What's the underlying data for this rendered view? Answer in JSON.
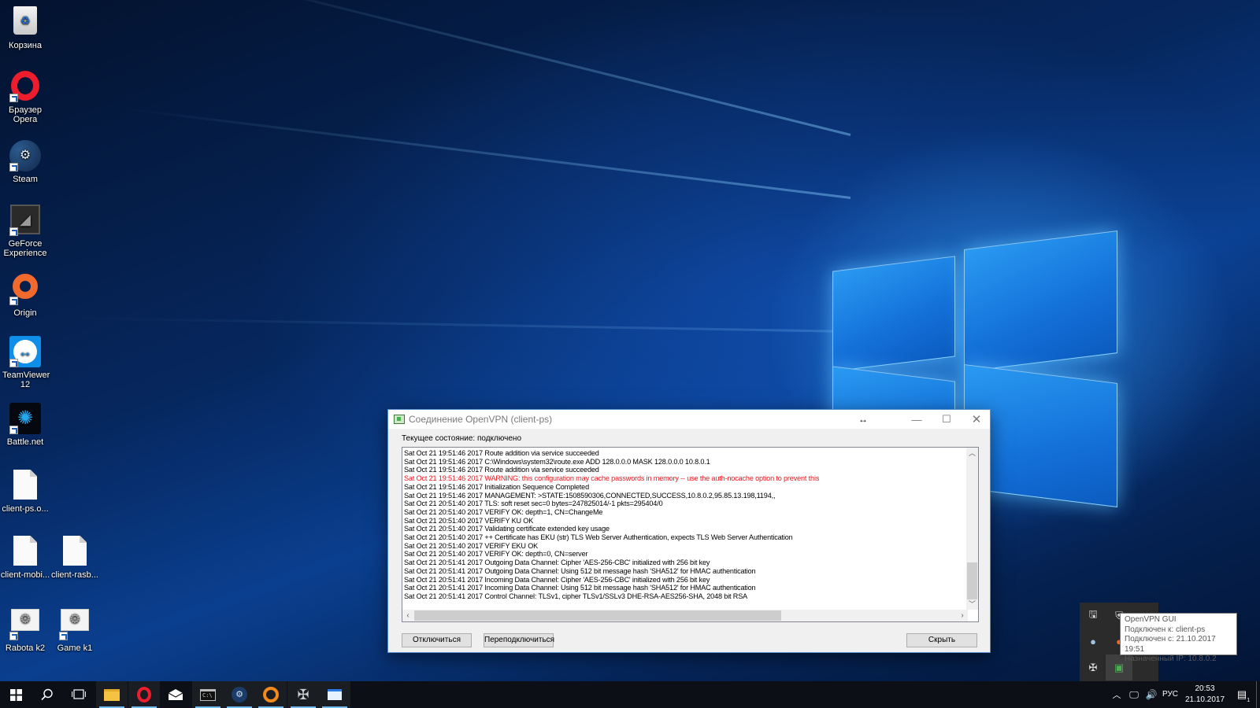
{
  "desktop": {
    "icons": [
      {
        "label": "Корзина",
        "icon": "recycle-bin-icon"
      },
      {
        "label": "Браузер Opera",
        "icon": "opera-icon"
      },
      {
        "label": "Steam",
        "icon": "steam-icon"
      },
      {
        "label": "GeForce Experience",
        "icon": "geforce-icon"
      },
      {
        "label": "Origin",
        "icon": "origin-icon"
      },
      {
        "label": "TeamViewer 12",
        "icon": "teamviewer-icon"
      },
      {
        "label": "Battle.net",
        "icon": "battlenet-icon"
      },
      {
        "label": "client-ps.o...",
        "icon": "file-icon"
      },
      {
        "label": "client-mobi...",
        "icon": "file-icon"
      },
      {
        "label": "client-rasb...",
        "icon": "file-icon"
      },
      {
        "label": "Rabota k2",
        "icon": "settings-shortcut-icon"
      },
      {
        "label": "Game k1",
        "icon": "settings-shortcut-icon"
      }
    ]
  },
  "vpn_window": {
    "title": "Соединение OpenVPN (client-ps)",
    "status": "Текущее состояние: подключено",
    "log": [
      {
        "text": "Sat Oct 21 19:51:46 2017 Route addition via service succeeded",
        "warn": false
      },
      {
        "text": "Sat Oct 21 19:51:46 2017 C:\\Windows\\system32\\route.exe ADD 128.0.0.0 MASK 128.0.0.0 10.8.0.1",
        "warn": false
      },
      {
        "text": "Sat Oct 21 19:51:46 2017 Route addition via service succeeded",
        "warn": false
      },
      {
        "text": "Sat Oct 21 19:51:46 2017 WARNING: this configuration may cache passwords in memory -- use the auth-nocache option to prevent this",
        "warn": true
      },
      {
        "text": "Sat Oct 21 19:51:46 2017 Initialization Sequence Completed",
        "warn": false
      },
      {
        "text": "Sat Oct 21 19:51:46 2017 MANAGEMENT: >STATE:1508590306,CONNECTED,SUCCESS,10.8.0.2,95.85.13.198,1194,,",
        "warn": false
      },
      {
        "text": "Sat Oct 21 20:51:40 2017 TLS: soft reset sec=0 bytes=247825014/-1 pkts=295404/0",
        "warn": false
      },
      {
        "text": "Sat Oct 21 20:51:40 2017 VERIFY OK: depth=1, CN=ChangeMe",
        "warn": false
      },
      {
        "text": "Sat Oct 21 20:51:40 2017 VERIFY KU OK",
        "warn": false
      },
      {
        "text": "Sat Oct 21 20:51:40 2017 Validating certificate extended key usage",
        "warn": false
      },
      {
        "text": "Sat Oct 21 20:51:40 2017 ++ Certificate has EKU (str) TLS Web Server Authentication, expects TLS Web Server Authentication",
        "warn": false
      },
      {
        "text": "Sat Oct 21 20:51:40 2017 VERIFY EKU OK",
        "warn": false
      },
      {
        "text": "Sat Oct 21 20:51:40 2017 VERIFY OK: depth=0, CN=server",
        "warn": false
      },
      {
        "text": "Sat Oct 21 20:51:41 2017 Outgoing Data Channel: Cipher 'AES-256-CBC' initialized with 256 bit key",
        "warn": false
      },
      {
        "text": "Sat Oct 21 20:51:41 2017 Outgoing Data Channel: Using 512 bit message hash 'SHA512' for HMAC authentication",
        "warn": false
      },
      {
        "text": "Sat Oct 21 20:51:41 2017 Incoming Data Channel: Cipher 'AES-256-CBC' initialized with 256 bit key",
        "warn": false
      },
      {
        "text": "Sat Oct 21 20:51:41 2017 Incoming Data Channel: Using 512 bit message hash 'SHA512' for HMAC authentication",
        "warn": false
      },
      {
        "text": "Sat Oct 21 20:51:41 2017 Control Channel: TLSv1, cipher TLSv1/SSLv3 DHE-RSA-AES256-SHA, 2048 bit RSA",
        "warn": false
      }
    ],
    "buttons": {
      "disconnect": "Отключиться",
      "reconnect": "Переподключиться",
      "hide": "Скрыть"
    },
    "colors": {
      "warning": "#e8161c"
    }
  },
  "tray_tooltip": {
    "lines": [
      "OpenVPN GUI",
      "Подключен к: client-ps",
      "Подключен с: 21.10.2017 19:51",
      "Назначенный IP: 10.8.0.2"
    ]
  },
  "taskbar": {
    "language": "РУС",
    "time": "20:53",
    "date": "21.10.2017",
    "notification_count": "1",
    "apps": [
      "start",
      "search",
      "task-view",
      "file-explorer",
      "opera",
      "mail",
      "cmd",
      "steam",
      "origin",
      "battlenet-tool",
      "openvpn-window"
    ]
  }
}
